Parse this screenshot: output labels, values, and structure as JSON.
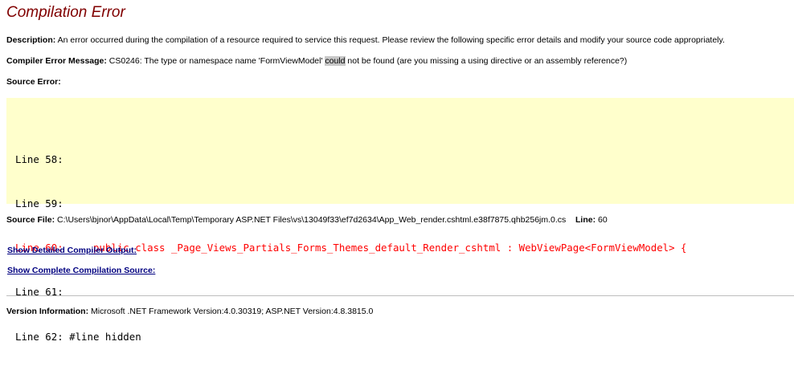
{
  "page": {
    "title": "Compilation Error"
  },
  "description": {
    "label": "Description:",
    "text": " An error occurred during the compilation of a resource required to service this request. Please review the following specific error details and modify your source code appropriately."
  },
  "compiler_message": {
    "label": "Compiler Error Message:",
    "text_before": " CS0246: The type or namespace name 'FormViewModel' ",
    "highlight": "could",
    "text_after": " not be found (are you missing a using directive or an assembly reference?)"
  },
  "source_error": {
    "label": "Source Error:",
    "lines": [
      "Line 58:",
      "Line 59:",
      "Line 60:     public class _Page_Views_Partials_Forms_Themes_default_Render_cshtml : WebViewPage<FormViewModel> {",
      "Line 61:",
      "Line 62: #line hidden"
    ]
  },
  "source_file": {
    "label": "Source File:",
    "path": " C:\\Users\\bjnor\\AppData\\Local\\Temp\\Temporary ASP.NET Files\\vs\\13049f33\\ef7d2634\\App_Web_render.cshtml.e38f7875.qhb256jm.0.cs",
    "line_label": "Line:",
    "line_value": " 60"
  },
  "links": {
    "compiler_output": "Show Detailed Compiler Output:",
    "compilation_source": "Show Complete Compilation Source:"
  },
  "version": {
    "label": "Version Information:",
    "text": " Microsoft .NET Framework Version:4.0.30319; ASP.NET Version:4.8.3815.0"
  },
  "colors": {
    "title": "#800000",
    "code_background": "#ffffcc",
    "error_line": "#ff0000",
    "link": "#000080"
  }
}
